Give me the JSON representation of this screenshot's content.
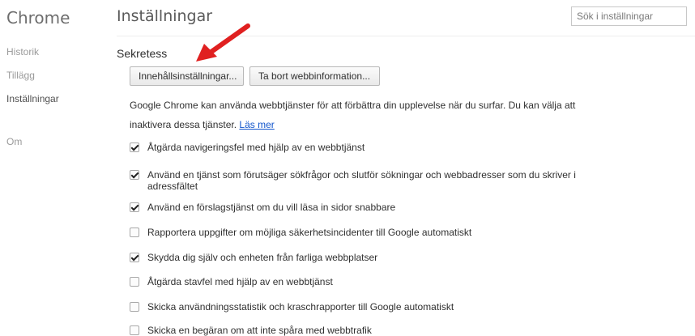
{
  "sidebar": {
    "brand": "Chrome",
    "items": [
      {
        "label": "Historik"
      },
      {
        "label": "Tillägg"
      },
      {
        "label": "Inställningar"
      },
      {
        "label": "Om"
      }
    ]
  },
  "header": {
    "title": "Inställningar",
    "search_placeholder": "Sök i inställningar"
  },
  "privacy": {
    "section_title": "Sekretess",
    "content_settings_button": "Innehållsinställningar...",
    "clear_data_button": "Ta bort webbinformation...",
    "description": "Google Chrome kan använda webbtjänster för att förbättra din upplevelse när du surfar. Du kan välja att inaktivera dessa tjänster.",
    "learn_more": "Läs mer",
    "options": [
      {
        "label": "Åtgärda navigeringsfel med hjälp av en webbtjänst",
        "checked": true
      },
      {
        "label": "Använd en tjänst som förutsäger sökfrågor och slutför sökningar och webbadresser som du skriver i adressfältet",
        "checked": true
      },
      {
        "label": "Använd en förslagstjänst om du vill läsa in sidor snabbare",
        "checked": true
      },
      {
        "label": "Rapportera uppgifter om möjliga säkerhetsincidenter till Google automatiskt",
        "checked": false
      },
      {
        "label": "Skydda dig själv och enheten från farliga webbplatser",
        "checked": true
      },
      {
        "label": "Åtgärda stavfel med hjälp av en webbtjänst",
        "checked": false
      },
      {
        "label": "Skicka användningsstatistik och kraschrapporter till Google automatiskt",
        "checked": false
      },
      {
        "label": "Skicka en begäran om att inte spåra med webbtrafik",
        "checked": false
      }
    ]
  },
  "colors": {
    "link": "#1155cc",
    "annotation_arrow": "#e02020"
  }
}
